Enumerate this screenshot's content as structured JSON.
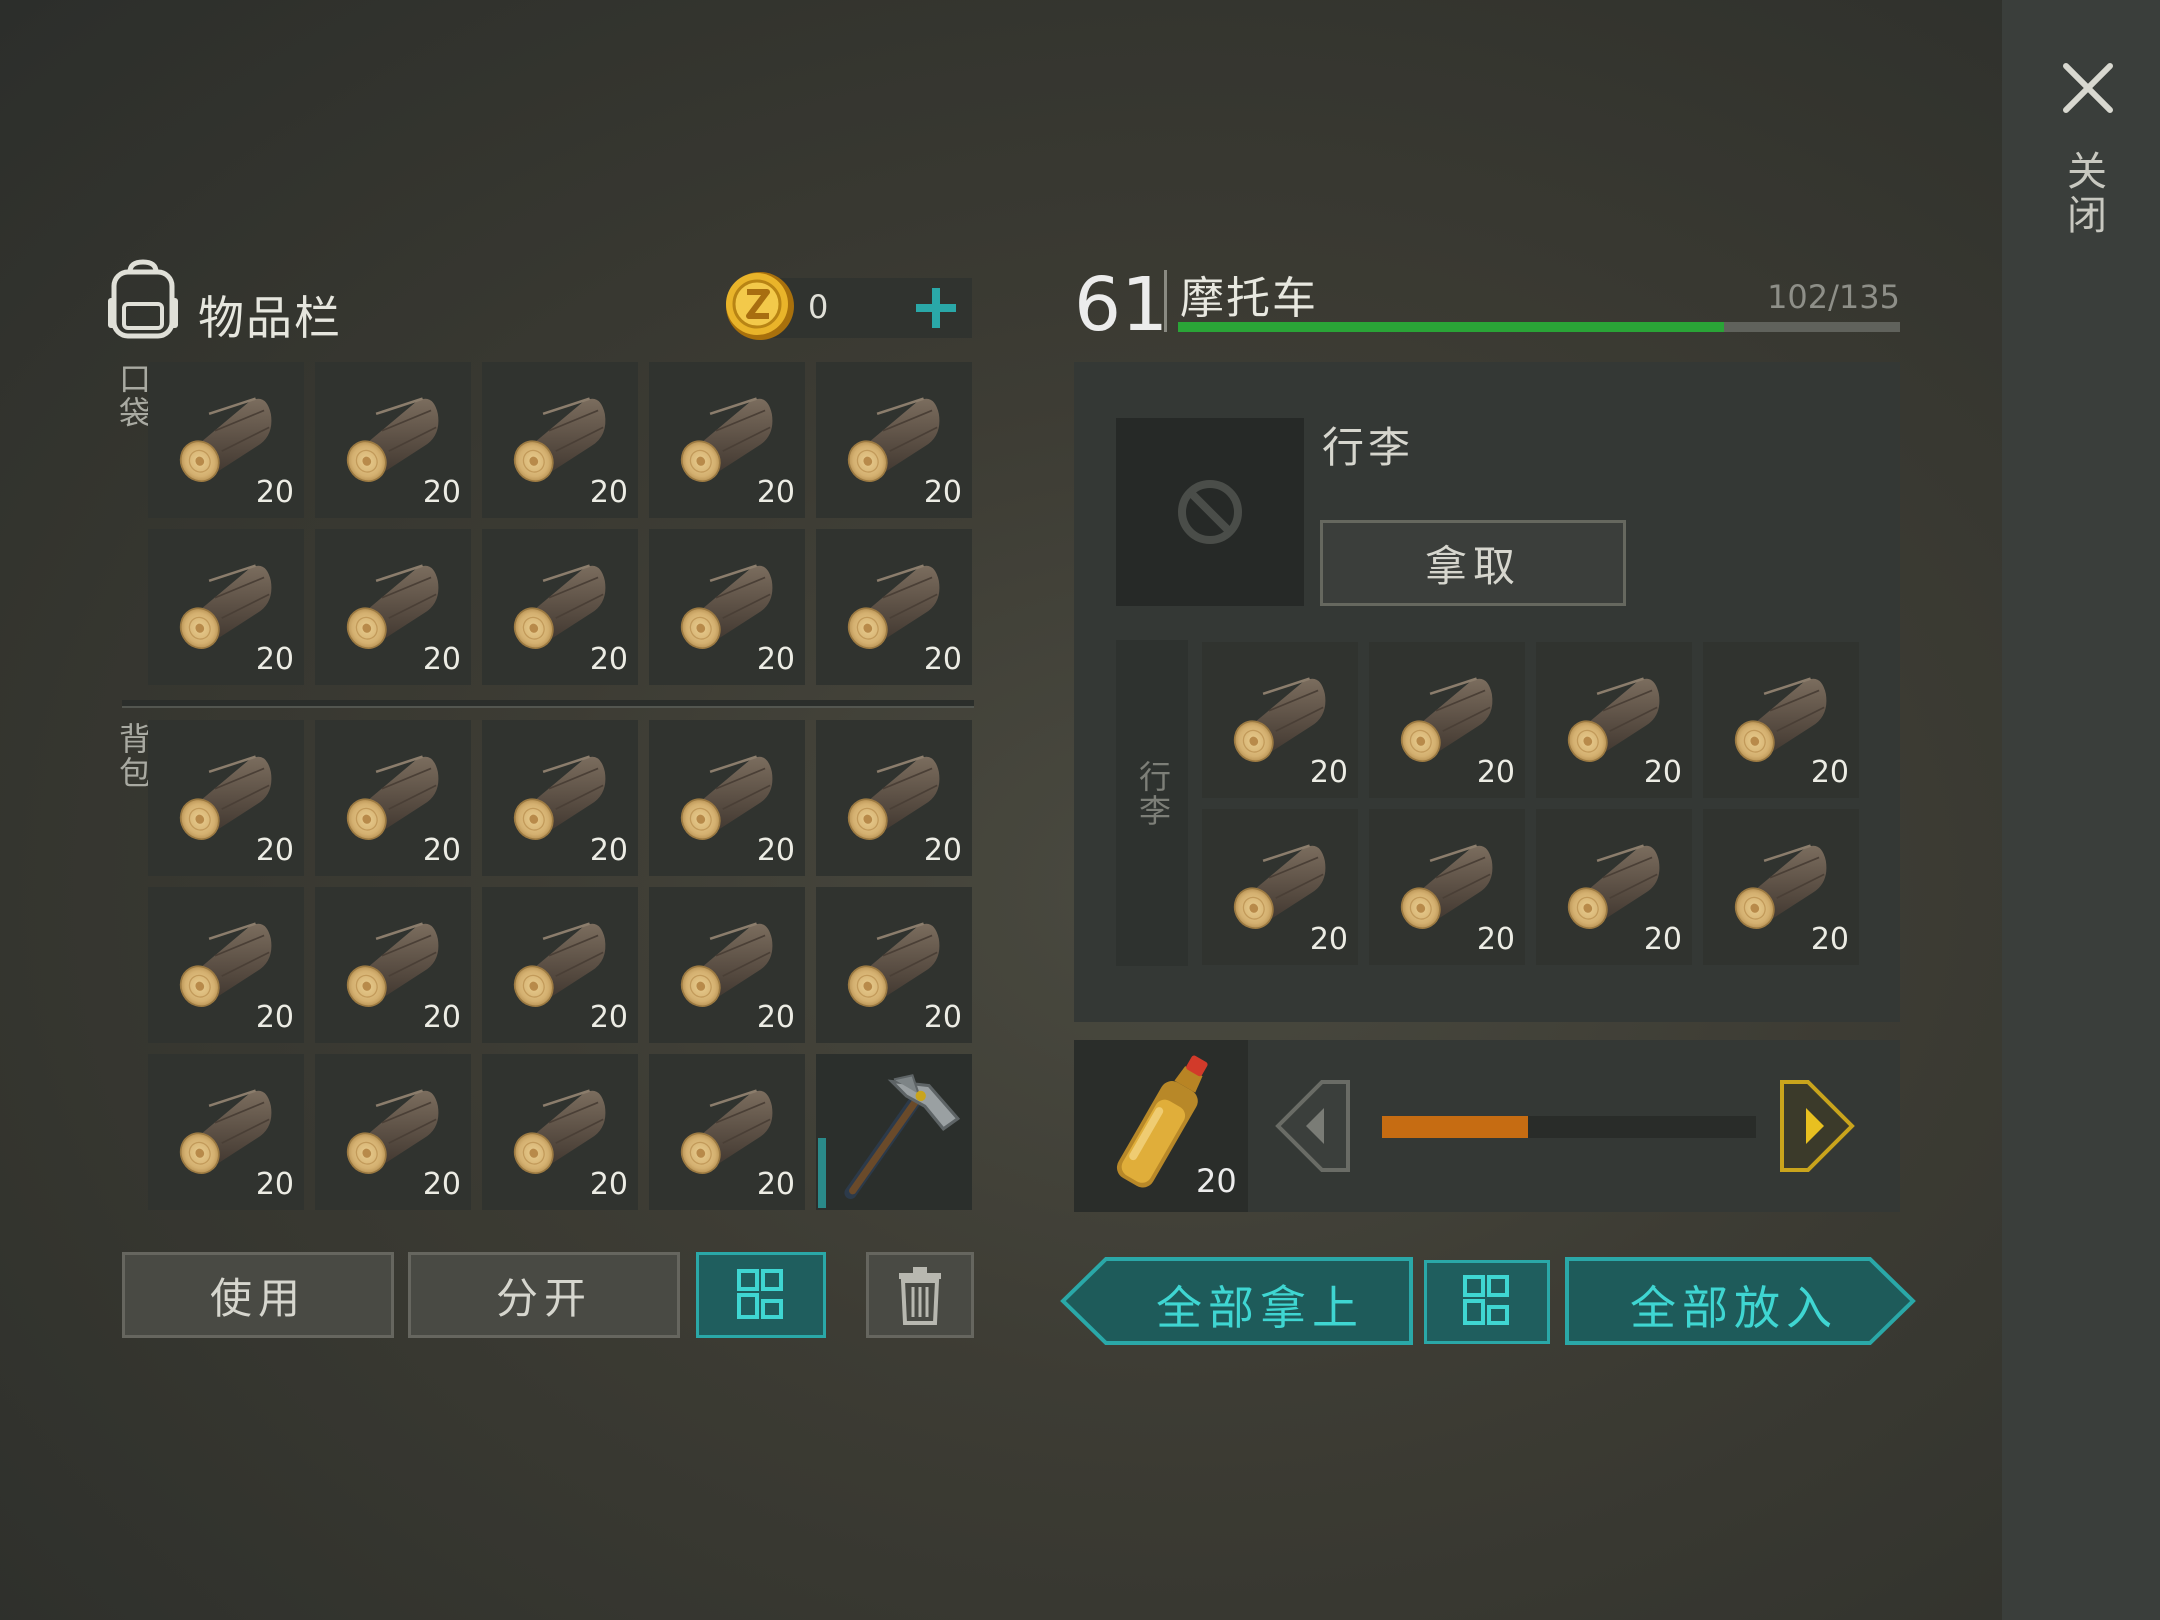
{
  "close": {
    "label": "关闭"
  },
  "inventory": {
    "title": "物品栏",
    "coins": "0",
    "pocket_label": "口袋",
    "backpack_label": "背包",
    "pocket": [
      {
        "item": "log",
        "qty": "20"
      },
      {
        "item": "log",
        "qty": "20"
      },
      {
        "item": "log",
        "qty": "20"
      },
      {
        "item": "log",
        "qty": "20"
      },
      {
        "item": "log",
        "qty": "20"
      },
      {
        "item": "log",
        "qty": "20"
      },
      {
        "item": "log",
        "qty": "20"
      },
      {
        "item": "log",
        "qty": "20"
      },
      {
        "item": "log",
        "qty": "20"
      },
      {
        "item": "log",
        "qty": "20"
      }
    ],
    "backpack": [
      {
        "item": "log",
        "qty": "20"
      },
      {
        "item": "log",
        "qty": "20"
      },
      {
        "item": "log",
        "qty": "20"
      },
      {
        "item": "log",
        "qty": "20"
      },
      {
        "item": "log",
        "qty": "20"
      },
      {
        "item": "log",
        "qty": "20"
      },
      {
        "item": "log",
        "qty": "20"
      },
      {
        "item": "log",
        "qty": "20"
      },
      {
        "item": "log",
        "qty": "20"
      },
      {
        "item": "log",
        "qty": "20"
      },
      {
        "item": "log",
        "qty": "20"
      },
      {
        "item": "log",
        "qty": "20"
      },
      {
        "item": "log",
        "qty": "20"
      },
      {
        "item": "log",
        "qty": "20"
      },
      {
        "item": "hatchet",
        "qty": ""
      }
    ],
    "use_label": "使用",
    "split_label": "分开"
  },
  "vehicle": {
    "level": "61",
    "name": "摩托车",
    "capacity_text": "102/135",
    "capacity_fraction": 0.756,
    "luggage_title": "行李",
    "take_label": "拿取",
    "luggage_side_label": "行李",
    "luggage": [
      {
        "item": "log",
        "qty": "20"
      },
      {
        "item": "log",
        "qty": "20"
      },
      {
        "item": "log",
        "qty": "20"
      },
      {
        "item": "log",
        "qty": "20"
      },
      {
        "item": "log",
        "qty": "20"
      },
      {
        "item": "log",
        "qty": "20"
      },
      {
        "item": "log",
        "qty": "20"
      },
      {
        "item": "log",
        "qty": "20"
      }
    ]
  },
  "fuel": {
    "item": "gasoline-bottle",
    "qty": "20",
    "level_fraction": 0.39
  },
  "actions": {
    "take_all_label": "全部拿上",
    "put_all_label": "全部放入"
  },
  "colors": {
    "accent_teal": "#2aa8a8",
    "capacity_green": "#2aa437",
    "fuel_orange": "#c66c12",
    "arrow_gold": "#c9a41c"
  }
}
